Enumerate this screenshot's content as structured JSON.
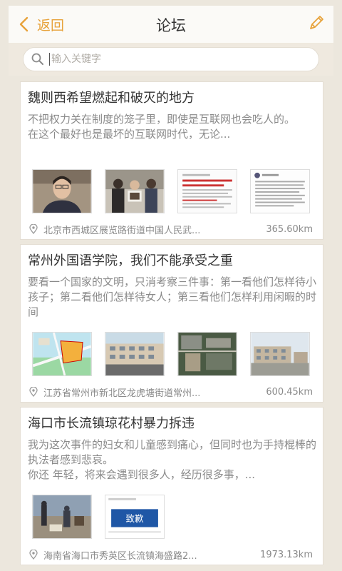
{
  "header": {
    "back_label": "返回",
    "title": "论坛"
  },
  "search": {
    "placeholder": "输入关键字"
  },
  "posts": [
    {
      "title": "魏则西希望燃起和破灭的地方",
      "description": "不把权力关在制度的笼子里，即使是互联网也会吃人的。\n在这个最好也是最坏的互联网时代，无论...",
      "location": "北京市西城区展览路街道中国人民武...",
      "distance": "365.60km",
      "thumbnail_caption": ""
    },
    {
      "title": "常州外国语学院，我们不能承受之重",
      "description": "要看一个国家的文明，只消考察三件事：第一看他们怎样待小孩子；第二看他们怎样待女人；第三看他们怎样利用闲暇的时间",
      "location": "江苏省常州市新北区龙虎塘街道常州...",
      "distance": "600.45km",
      "thumbnail_caption": ""
    },
    {
      "title": "海口市长流镇琼花村暴力拆违",
      "description": "我为这次事件的妇女和儿童感到痛心，但同时也为手持棍棒的执法者感到悲哀。\n你还 年轻，将来会遇到很多人，经历很多事，...",
      "location": "海南省海口市秀英区长流镇海盛路2...",
      "distance": "1973.13km",
      "thumbnail_caption": "致歉"
    }
  ],
  "colors": {
    "accent": "#e7a23a",
    "background": "#ece7dd",
    "card": "#ffffff",
    "text_primary": "#333333",
    "text_secondary": "#8a8a8a"
  }
}
